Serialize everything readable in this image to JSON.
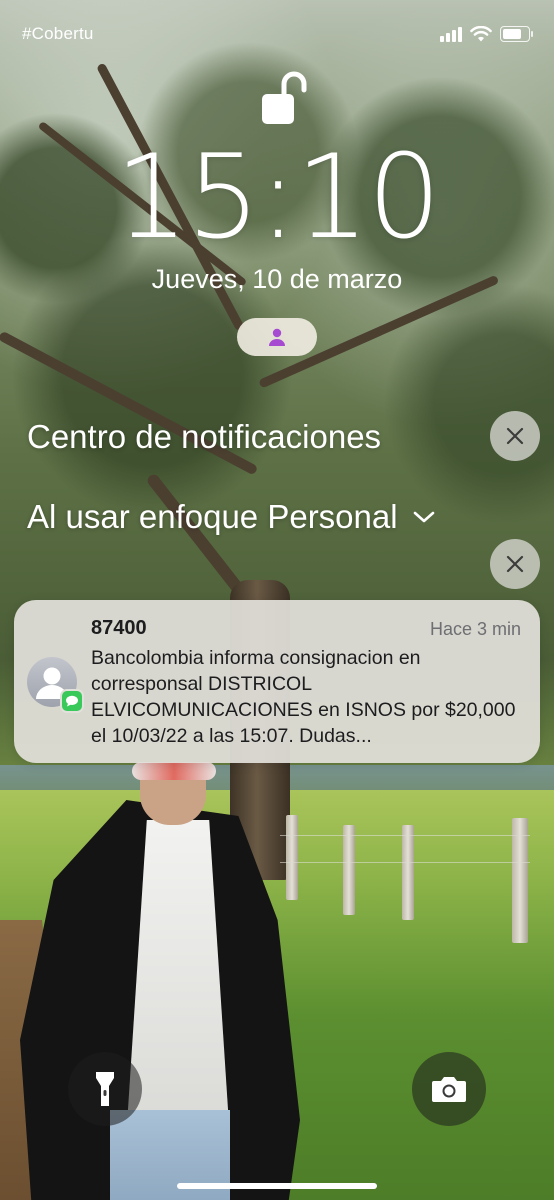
{
  "status_bar": {
    "carrier": "#Cobertu",
    "signal_bars": 4,
    "wifi": true,
    "battery_level": 0.75
  },
  "lock_screen": {
    "lock_state": "unlocked",
    "time": "15:10",
    "date": "Jueves, 10 de marzo",
    "focus_icon": "person-icon",
    "focus_color": "#a64bd1"
  },
  "notification_center": {
    "title": "Centro de notificaciones",
    "focus_section": "Al usar enfoque Personal",
    "notifications": [
      {
        "app": "Messages",
        "sender": "87400",
        "time": "Hace 3 min",
        "body": "Bancolombia informa consignacion en corresponsal DISTRICOL ELVICOMUNICACIONES en ISNOS por $20,000 el 10/03/22 a las 15:07. Dudas..."
      }
    ]
  },
  "quick_actions": {
    "left": "flashlight-icon",
    "right": "camera-icon"
  },
  "colors": {
    "notification_bg": "#e2e0da",
    "messages_green": "#38c95a",
    "close_button_bg": "#d7d7d2"
  }
}
